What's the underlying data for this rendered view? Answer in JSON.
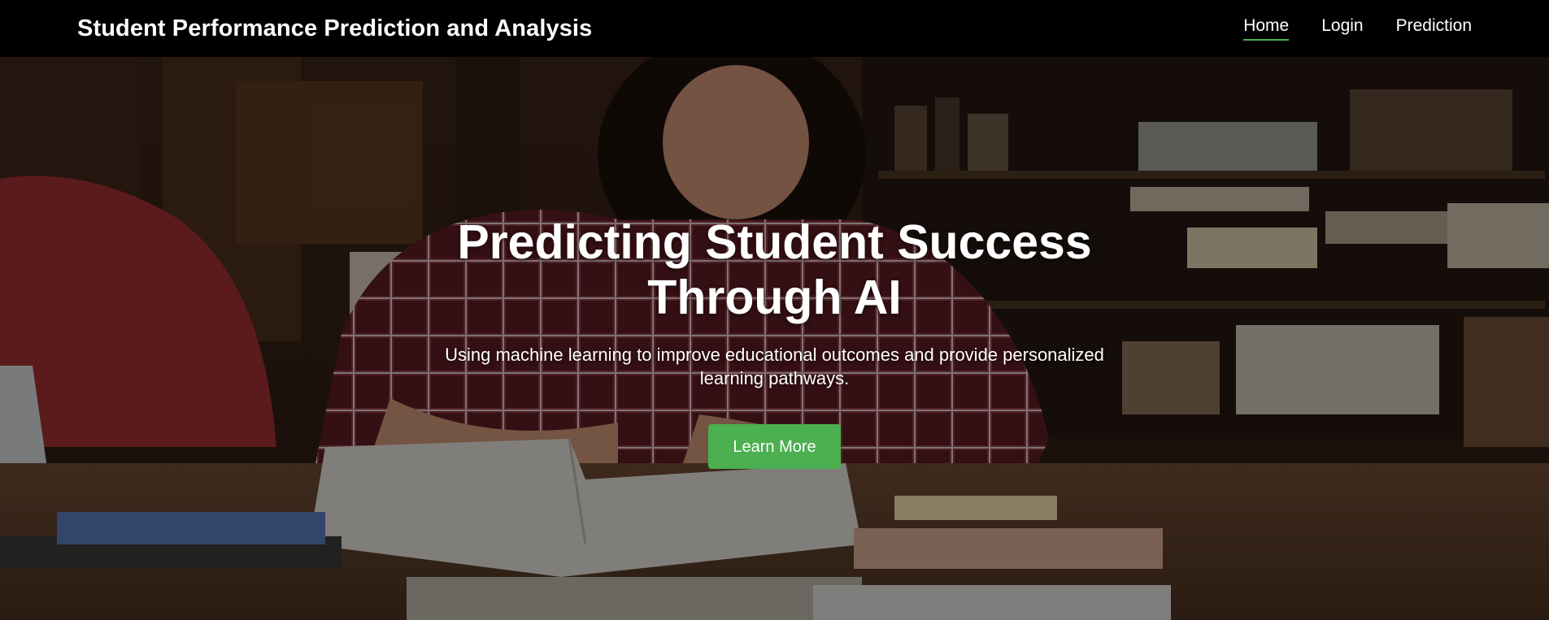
{
  "header": {
    "brand": "Student Performance Prediction and Analysis",
    "nav": [
      {
        "label": "Home",
        "active": true
      },
      {
        "label": "Login",
        "active": false
      },
      {
        "label": "Prediction",
        "active": false
      }
    ]
  },
  "hero": {
    "title_line1": "Predicting Student Success",
    "title_line2": "Through AI",
    "subtitle_line1": "Using machine learning to improve educational outcomes and provide personalized",
    "subtitle_line2": "learning pathways.",
    "cta_label": "Learn More"
  },
  "colors": {
    "accent": "#4caf50",
    "navbar_bg": "#000000"
  }
}
